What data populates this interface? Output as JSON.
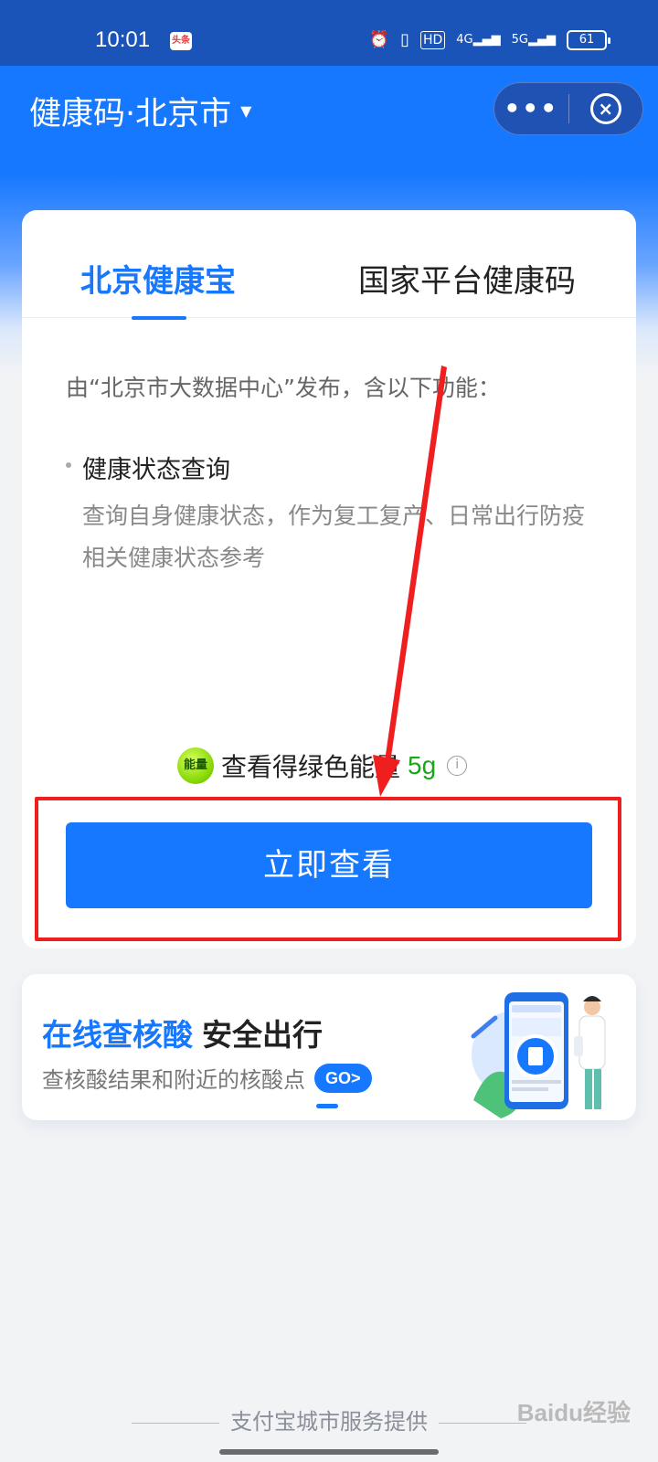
{
  "status_bar": {
    "time": "10:01",
    "badge": "头条",
    "network_hd": "HD",
    "net_4g": "4G",
    "net_5g": "5G",
    "battery": "61"
  },
  "header": {
    "title": "健康码·北京市",
    "more_label": "•••"
  },
  "tabs": [
    {
      "label": "北京健康宝",
      "active": true
    },
    {
      "label": "国家平台健康码",
      "active": false
    }
  ],
  "content": {
    "description": "由“北京市大数据中心”发布，含以下功能：",
    "feature_title": "健康状态查询",
    "feature_desc": "查询自身健康状态，作为复工复产、日常出行防疫相关健康状态参考"
  },
  "energy": {
    "icon_text": "能量",
    "text": "查看得绿色能量",
    "value": "5g"
  },
  "primary_button": "立即查看",
  "banner": {
    "title_blue": "在线查核酸",
    "title_dark": "安全出行",
    "subtitle": "查核酸结果和附近的核酸点",
    "go": "GO>"
  },
  "footer": "支付宝城市服务提供",
  "watermark": "Baidu经验",
  "colors": {
    "brand_blue": "#1677ff",
    "status_bar": "#1a54b8",
    "annotation_red": "#f01f1f",
    "energy_green": "#1aa61a"
  }
}
